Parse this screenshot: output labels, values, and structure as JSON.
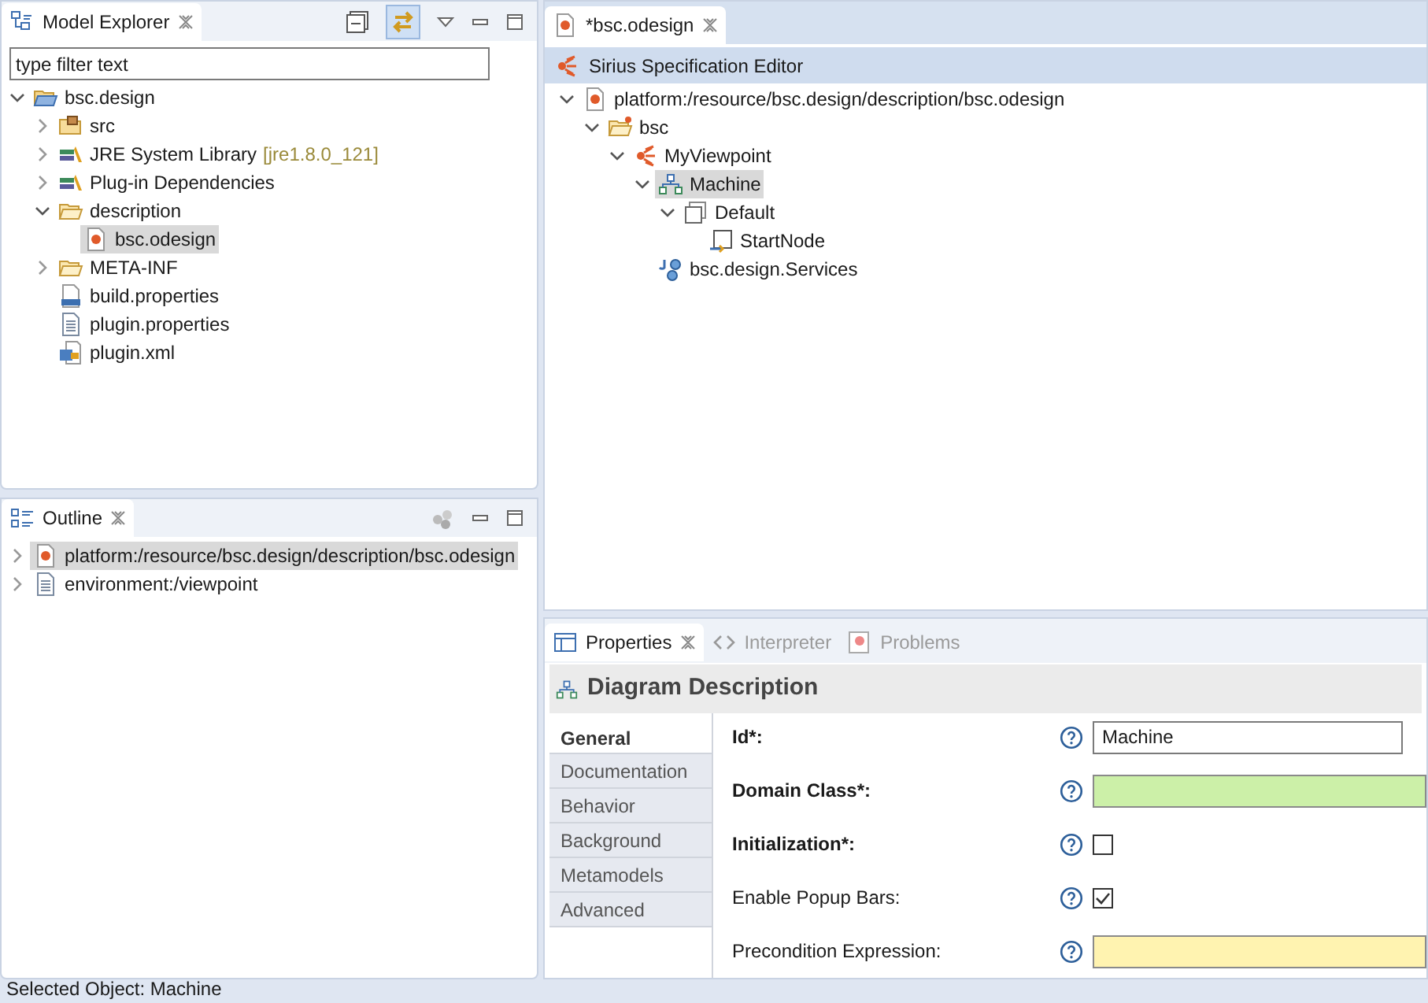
{
  "model_explorer": {
    "tab": {
      "title": "Model Explorer",
      "selected": true
    },
    "filter": {
      "placeholder": "type filter text"
    },
    "tree": [
      {
        "label": "bsc.design",
        "kind": "project",
        "expanded": true,
        "selected": false,
        "children": [
          {
            "label": "src",
            "kind": "package-folder",
            "expanded": false,
            "selected": false
          },
          {
            "label": "JRE System Library",
            "decoration": "[jre1.8.0_121]",
            "kind": "library",
            "expanded": false,
            "selected": false
          },
          {
            "label": "Plug-in Dependencies",
            "kind": "library",
            "expanded": false,
            "selected": false
          },
          {
            "label": "description",
            "kind": "folder",
            "expanded": true,
            "selected": false,
            "children": [
              {
                "label": "bsc.odesign",
                "kind": "odesign",
                "selected": true
              }
            ]
          },
          {
            "label": "META-INF",
            "kind": "folder",
            "expanded": false,
            "selected": false
          },
          {
            "label": "build.properties",
            "kind": "binary-file",
            "selected": false
          },
          {
            "label": "plugin.properties",
            "kind": "text-file",
            "selected": false
          },
          {
            "label": "plugin.xml",
            "kind": "plugin-file",
            "selected": false
          }
        ]
      }
    ]
  },
  "outline": {
    "tab": {
      "title": "Outline",
      "selected": true
    },
    "tree": [
      {
        "label": "platform:/resource/bsc.design/description/bsc.odesign",
        "kind": "odesign",
        "expanded": false,
        "selected": true
      },
      {
        "label": "environment:/viewpoint",
        "kind": "text-file",
        "expanded": false,
        "selected": false
      }
    ]
  },
  "editor": {
    "tab": {
      "title": "*bsc.odesign",
      "selected": true
    },
    "header": "Sirius Specification Editor",
    "tree": [
      {
        "label": "platform:/resource/bsc.design/description/bsc.odesign",
        "kind": "odesign",
        "expanded": true,
        "selected": false,
        "children": [
          {
            "label": "bsc",
            "kind": "group-folder",
            "expanded": true,
            "selected": false,
            "children": [
              {
                "label": "MyViewpoint",
                "kind": "viewpoint",
                "expanded": true,
                "selected": false,
                "children": [
                  {
                    "label": "Machine",
                    "kind": "diagram",
                    "expanded": true,
                    "selected": true,
                    "children": [
                      {
                        "label": "Default",
                        "kind": "layer",
                        "expanded": true,
                        "selected": false,
                        "children": [
                          {
                            "label": "StartNode",
                            "kind": "node",
                            "selected": false
                          }
                        ]
                      }
                    ]
                  },
                  {
                    "label": "bsc.design.Services",
                    "kind": "java-service",
                    "selected": false
                  }
                ]
              }
            ]
          }
        ]
      }
    ]
  },
  "properties": {
    "tabs": [
      {
        "title": "Properties",
        "kind": "properties",
        "selected": true
      },
      {
        "title": "Interpreter",
        "kind": "interpreter",
        "selected": false
      },
      {
        "title": "Problems",
        "kind": "problems",
        "selected": false
      }
    ],
    "heading": "Diagram Description",
    "sections": [
      {
        "label": "General",
        "selected": true
      },
      {
        "label": "Documentation",
        "selected": false
      },
      {
        "label": "Behavior",
        "selected": false
      },
      {
        "label": "Background",
        "selected": false
      },
      {
        "label": "Metamodels",
        "selected": false
      },
      {
        "label": "Advanced",
        "selected": false
      }
    ],
    "fields": [
      {
        "label": "Id*:",
        "required": true,
        "kind": "text",
        "value": "Machine"
      },
      {
        "label": "Domain Class*:",
        "required": true,
        "kind": "class"
      },
      {
        "label": "Initialization*:",
        "required": true,
        "kind": "checkbox",
        "checked": false
      },
      {
        "label": "Enable Popup Bars:",
        "required": false,
        "kind": "checkbox",
        "checked": true
      },
      {
        "label": "Precondition Expression:",
        "required": false,
        "kind": "expression"
      }
    ]
  },
  "status_bar": "Selected Object: Machine"
}
